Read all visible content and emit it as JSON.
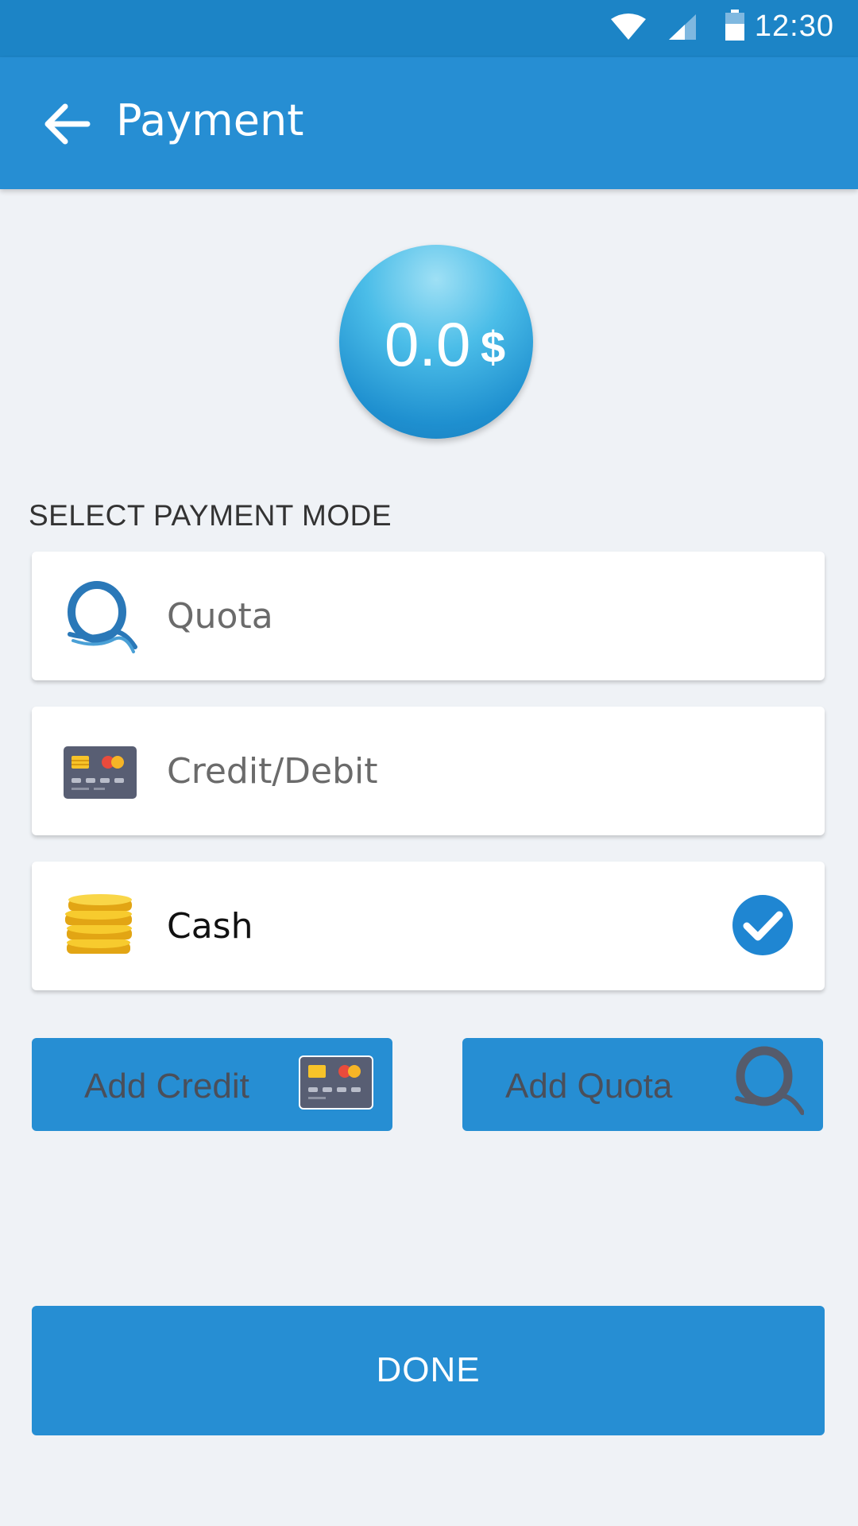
{
  "status_bar": {
    "time": "12:30",
    "icons": [
      "wifi-icon",
      "signal-icon",
      "battery-icon"
    ]
  },
  "app_bar": {
    "title": "Payment",
    "back_icon": "arrow-left-icon"
  },
  "amount": {
    "value": "0.0",
    "currency": "$"
  },
  "payment_section": {
    "label": "SELECT PAYMENT MODE",
    "modes": [
      {
        "label": "Quota",
        "icon": "quota-logo-icon",
        "selected": false
      },
      {
        "label": "Credit/Debit",
        "icon": "credit-card-icon",
        "selected": false
      },
      {
        "label": "Cash",
        "icon": "coins-icon",
        "selected": true
      }
    ]
  },
  "actions": {
    "add_credit": "Add Credit",
    "add_quota": "Add Quota"
  },
  "done": {
    "label": "DONE"
  },
  "colors": {
    "primary": "#268ed3",
    "status_bar": "#1c84c6",
    "background": "#eff2f6",
    "check": "#1f86d2"
  }
}
